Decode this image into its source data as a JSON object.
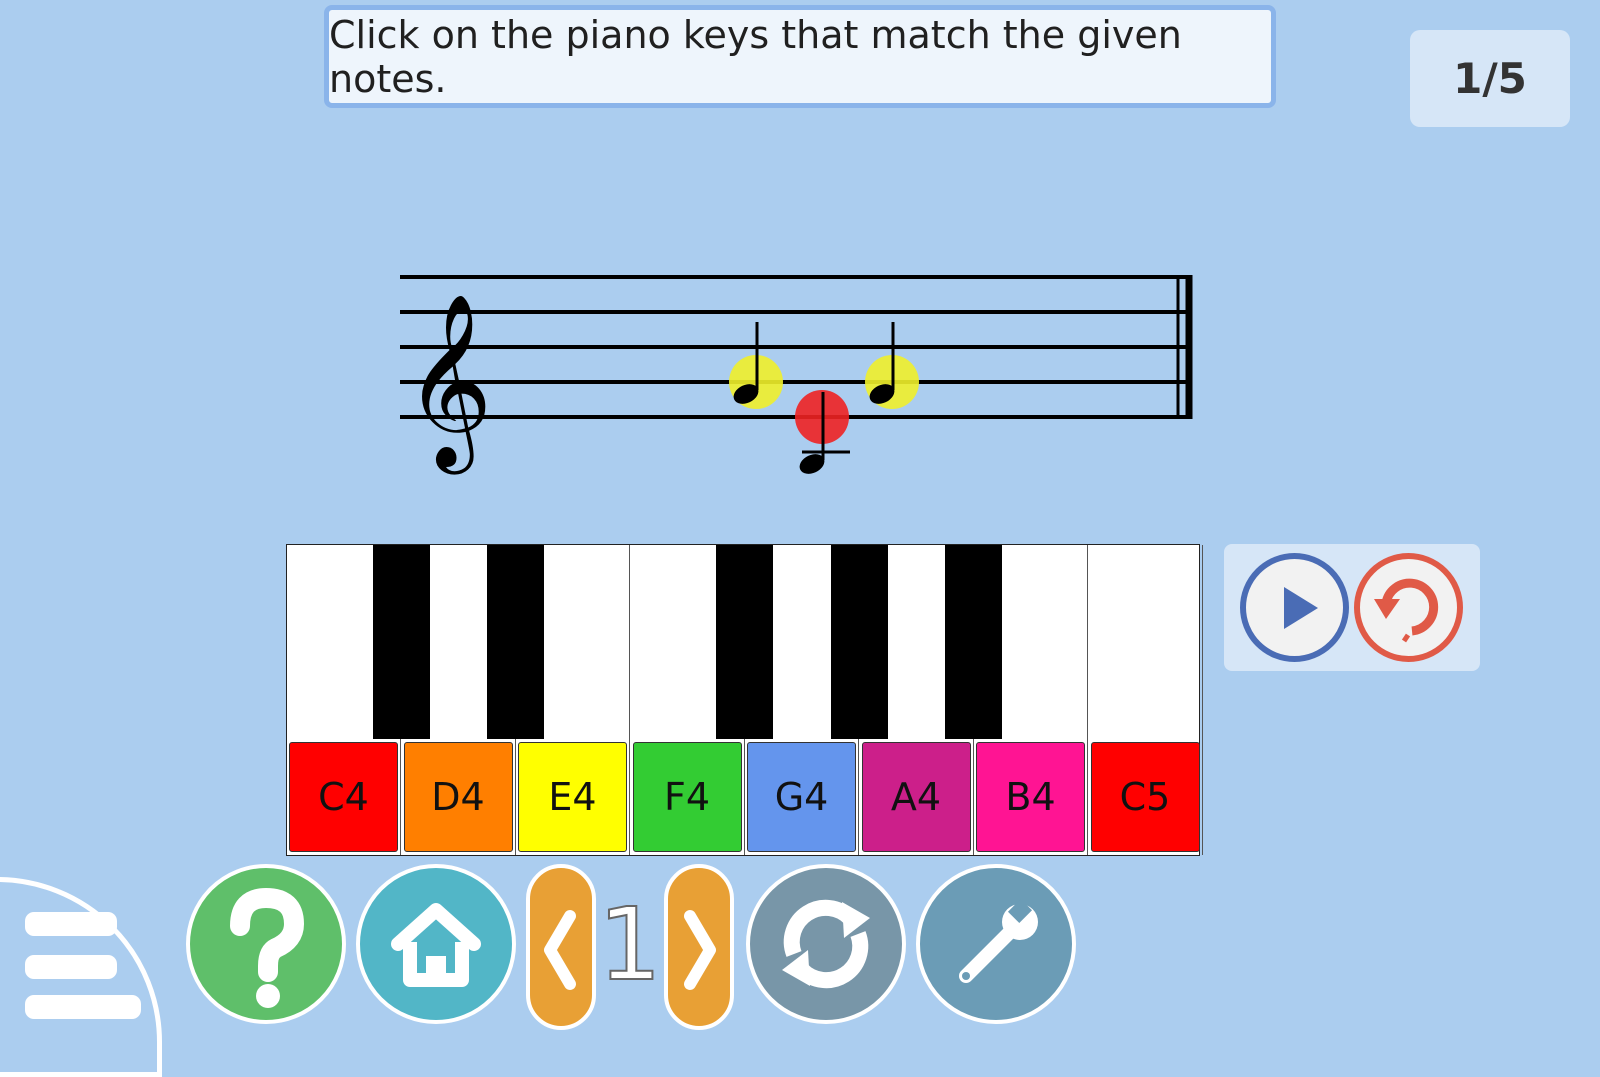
{
  "instruction": "Click on the piano keys that match the given notes.",
  "score": "1/5",
  "notes": [
    {
      "pitch": "G4",
      "highlight": "yellow"
    },
    {
      "pitch": "C4",
      "highlight": "red"
    },
    {
      "pitch": "G4",
      "highlight": "yellow"
    }
  ],
  "highlight_colors": {
    "yellow": "#f0ef2a",
    "red": "#ee2222"
  },
  "piano": {
    "white_keys": [
      {
        "label": "C4",
        "color": "#ff0000"
      },
      {
        "label": "D4",
        "color": "#ff7f00"
      },
      {
        "label": "E4",
        "color": "#ffff00"
      },
      {
        "label": "F4",
        "color": "#33cc33"
      },
      {
        "label": "G4",
        "color": "#6495ed"
      },
      {
        "label": "A4",
        "color": "#cc1f8a"
      },
      {
        "label": "B4",
        "color": "#ff1493"
      },
      {
        "label": "C5",
        "color": "#ff0000"
      }
    ],
    "black_keys": [
      "C#4",
      "D#4",
      "F#4",
      "G#4",
      "A#4"
    ]
  },
  "controls": {
    "play_icon": "play-icon",
    "undo_icon": "undo-icon"
  },
  "bottom_bar": {
    "menu_icon": "menu-icon",
    "help_icon": "question-mark-icon",
    "home_icon": "home-icon",
    "prev_icon": "chevron-left-icon",
    "level": "1",
    "next_icon": "chevron-right-icon",
    "reload_icon": "reload-icon",
    "settings_icon": "wrench-icon",
    "colors": {
      "help": "#5fbf6a",
      "home": "#52b6c7",
      "arrows": "#e8a035",
      "reload": "#7896a8",
      "settings": "#6b9cb6"
    }
  }
}
